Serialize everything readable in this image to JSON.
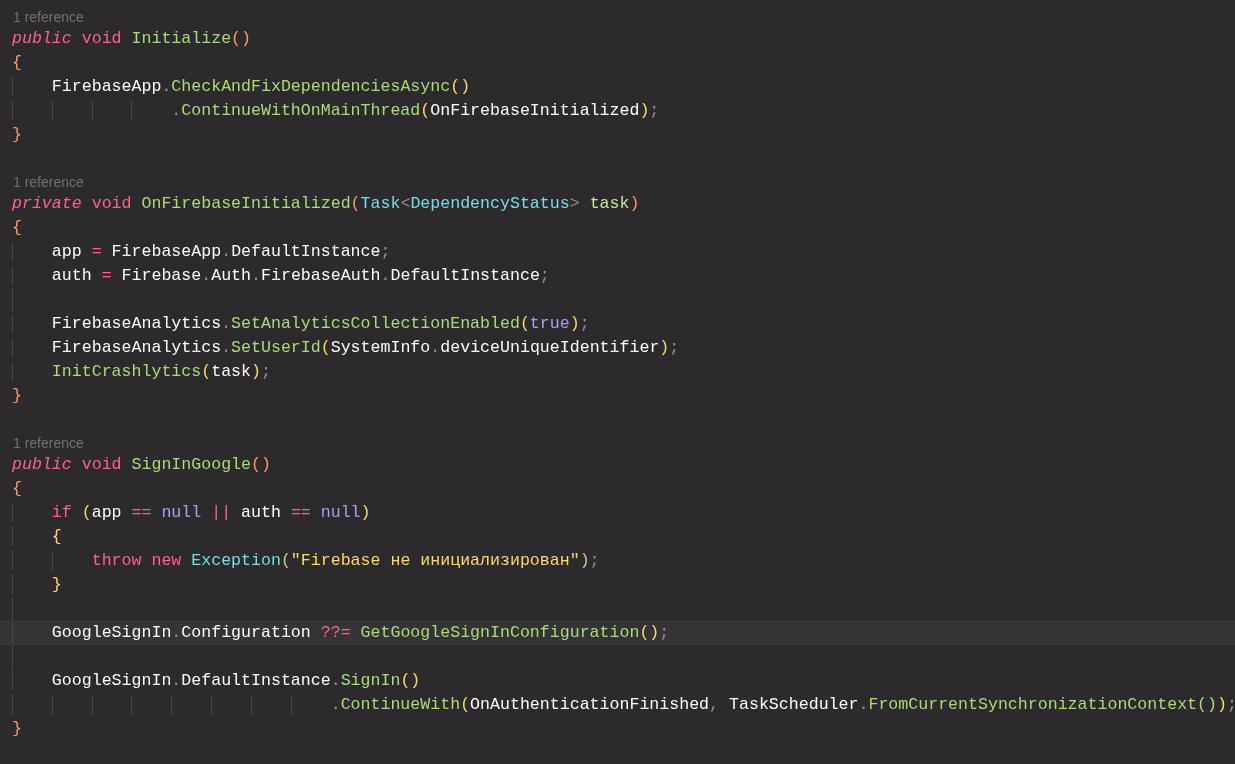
{
  "editor": {
    "lines": [
      {
        "kind": "lens",
        "text": "1 reference"
      },
      {
        "kind": "code",
        "tokens": [
          {
            "kind": "kwi",
            "text": "public "
          },
          {
            "kind": "kw",
            "text": "void "
          },
          {
            "kind": "fn",
            "text": "Initialize"
          },
          {
            "kind": "b1",
            "text": "()"
          }
        ]
      },
      {
        "kind": "code",
        "tokens": [
          {
            "kind": "b1",
            "text": "{"
          }
        ]
      },
      {
        "kind": "code",
        "tokens": [
          {
            "kind": "ident",
            "text": "    FirebaseApp"
          },
          {
            "kind": "punct",
            "text": "."
          },
          {
            "kind": "fn",
            "text": "CheckAndFixDependenciesAsync"
          },
          {
            "kind": "b2",
            "text": "()"
          }
        ]
      },
      {
        "kind": "code",
        "tokens": [
          {
            "kind": "punct",
            "text": "                ."
          },
          {
            "kind": "fn",
            "text": "ContinueWithOnMainThread"
          },
          {
            "kind": "b2",
            "text": "("
          },
          {
            "kind": "ident",
            "text": "OnFirebaseInitialized"
          },
          {
            "kind": "b2",
            "text": ")"
          },
          {
            "kind": "punct",
            "text": ";"
          }
        ]
      },
      {
        "kind": "code",
        "tokens": [
          {
            "kind": "b1",
            "text": "}"
          }
        ]
      },
      {
        "kind": "blank"
      },
      {
        "kind": "lens",
        "text": "1 reference"
      },
      {
        "kind": "code",
        "tokens": [
          {
            "kind": "kwi",
            "text": "private "
          },
          {
            "kind": "kw",
            "text": "void "
          },
          {
            "kind": "fn",
            "text": "OnFirebaseInitialized"
          },
          {
            "kind": "b1",
            "text": "("
          },
          {
            "kind": "type",
            "text": "Task"
          },
          {
            "kind": "punct",
            "text": "<"
          },
          {
            "kind": "type",
            "text": "DependencyStatus"
          },
          {
            "kind": "punct",
            "text": "> "
          },
          {
            "kind": "param",
            "text": "task"
          },
          {
            "kind": "b1",
            "text": ")"
          }
        ]
      },
      {
        "kind": "code",
        "tokens": [
          {
            "kind": "b1",
            "text": "{"
          }
        ]
      },
      {
        "kind": "code",
        "tokens": [
          {
            "kind": "ident",
            "text": "    app "
          },
          {
            "kind": "op",
            "text": "= "
          },
          {
            "kind": "ident",
            "text": "FirebaseApp"
          },
          {
            "kind": "punct",
            "text": "."
          },
          {
            "kind": "ident",
            "text": "DefaultInstance"
          },
          {
            "kind": "punct",
            "text": ";"
          }
        ]
      },
      {
        "kind": "code",
        "tokens": [
          {
            "kind": "ident",
            "text": "    auth "
          },
          {
            "kind": "op",
            "text": "= "
          },
          {
            "kind": "ident",
            "text": "Firebase"
          },
          {
            "kind": "punct",
            "text": "."
          },
          {
            "kind": "ident",
            "text": "Auth"
          },
          {
            "kind": "punct",
            "text": "."
          },
          {
            "kind": "ident",
            "text": "FirebaseAuth"
          },
          {
            "kind": "punct",
            "text": "."
          },
          {
            "kind": "ident",
            "text": "DefaultInstance"
          },
          {
            "kind": "punct",
            "text": ";"
          }
        ]
      },
      {
        "kind": "blank",
        "guides": true
      },
      {
        "kind": "code",
        "tokens": [
          {
            "kind": "ident",
            "text": "    FirebaseAnalytics"
          },
          {
            "kind": "punct",
            "text": "."
          },
          {
            "kind": "fn",
            "text": "SetAnalyticsCollectionEnabled"
          },
          {
            "kind": "b2",
            "text": "("
          },
          {
            "kind": "const",
            "text": "true"
          },
          {
            "kind": "b2",
            "text": ")"
          },
          {
            "kind": "punct",
            "text": ";"
          }
        ]
      },
      {
        "kind": "code",
        "tokens": [
          {
            "kind": "ident",
            "text": "    FirebaseAnalytics"
          },
          {
            "kind": "punct",
            "text": "."
          },
          {
            "kind": "fn",
            "text": "SetUserId"
          },
          {
            "kind": "b2",
            "text": "("
          },
          {
            "kind": "ident",
            "text": "SystemInfo"
          },
          {
            "kind": "punct",
            "text": "."
          },
          {
            "kind": "ident",
            "text": "deviceUniqueIdentifier"
          },
          {
            "kind": "b2",
            "text": ")"
          },
          {
            "kind": "punct",
            "text": ";"
          }
        ]
      },
      {
        "kind": "code",
        "tokens": [
          {
            "kind": "fn",
            "text": "    InitCrashlytics"
          },
          {
            "kind": "b2",
            "text": "("
          },
          {
            "kind": "ident",
            "text": "task"
          },
          {
            "kind": "b2",
            "text": ")"
          },
          {
            "kind": "punct",
            "text": ";"
          }
        ]
      },
      {
        "kind": "code",
        "tokens": [
          {
            "kind": "b1",
            "text": "}"
          }
        ]
      },
      {
        "kind": "blank"
      },
      {
        "kind": "lens",
        "text": "1 reference"
      },
      {
        "kind": "code",
        "tokens": [
          {
            "kind": "kwi",
            "text": "public "
          },
          {
            "kind": "kw",
            "text": "void "
          },
          {
            "kind": "fn",
            "text": "SignInGoogle"
          },
          {
            "kind": "b1",
            "text": "()"
          }
        ]
      },
      {
        "kind": "code",
        "tokens": [
          {
            "kind": "b1",
            "text": "{"
          }
        ]
      },
      {
        "kind": "code",
        "tokens": [
          {
            "kind": "kw",
            "text": "    if "
          },
          {
            "kind": "b2",
            "text": "("
          },
          {
            "kind": "ident",
            "text": "app "
          },
          {
            "kind": "op",
            "text": "== "
          },
          {
            "kind": "const",
            "text": "null "
          },
          {
            "kind": "op",
            "text": "|| "
          },
          {
            "kind": "ident",
            "text": "auth "
          },
          {
            "kind": "op",
            "text": "== "
          },
          {
            "kind": "const",
            "text": "null"
          },
          {
            "kind": "b2",
            "text": ")"
          }
        ]
      },
      {
        "kind": "code",
        "tokens": [
          {
            "kind": "b2",
            "text": "    {"
          }
        ]
      },
      {
        "kind": "code",
        "tokens": [
          {
            "kind": "kw",
            "text": "        throw new "
          },
          {
            "kind": "type",
            "text": "Exception"
          },
          {
            "kind": "b3",
            "text": "("
          },
          {
            "kind": "str",
            "text": "\"Firebase не инициализирован\""
          },
          {
            "kind": "b3",
            "text": ")"
          },
          {
            "kind": "punct",
            "text": ";"
          }
        ]
      },
      {
        "kind": "code",
        "tokens": [
          {
            "kind": "b2",
            "text": "    }"
          }
        ]
      },
      {
        "kind": "blank",
        "guides": true
      },
      {
        "kind": "code",
        "current": true,
        "tokens": [
          {
            "kind": "ident",
            "text": "    GoogleSignIn"
          },
          {
            "kind": "punct",
            "text": "."
          },
          {
            "kind": "ident",
            "text": "Configuration "
          },
          {
            "kind": "op",
            "text": "??= "
          },
          {
            "kind": "fn",
            "text": "GetGoogleSignInConfiguration"
          },
          {
            "kind": "b2",
            "text": "()"
          },
          {
            "kind": "punct",
            "text": ";"
          }
        ]
      },
      {
        "kind": "blank",
        "guides": true
      },
      {
        "kind": "code",
        "tokens": [
          {
            "kind": "ident",
            "text": "    GoogleSignIn"
          },
          {
            "kind": "punct",
            "text": "."
          },
          {
            "kind": "ident",
            "text": "DefaultInstance"
          },
          {
            "kind": "punct",
            "text": "."
          },
          {
            "kind": "fn",
            "text": "SignIn"
          },
          {
            "kind": "b2",
            "text": "()"
          }
        ]
      },
      {
        "kind": "code",
        "tokens": [
          {
            "kind": "punct",
            "text": "                                ."
          },
          {
            "kind": "fn",
            "text": "ContinueWith"
          },
          {
            "kind": "b2",
            "text": "("
          },
          {
            "kind": "ident",
            "text": "OnAuthenticationFinished"
          },
          {
            "kind": "punct",
            "text": ", "
          },
          {
            "kind": "ident",
            "text": "TaskScheduler"
          },
          {
            "kind": "punct",
            "text": "."
          },
          {
            "kind": "fn",
            "text": "FromCurrentSynchronizationContext"
          },
          {
            "kind": "b3",
            "text": "()"
          },
          {
            "kind": "b2",
            "text": ")"
          },
          {
            "kind": "punct",
            "text": ";"
          }
        ]
      },
      {
        "kind": "code",
        "tokens": [
          {
            "kind": "b1",
            "text": "}"
          }
        ]
      }
    ]
  }
}
